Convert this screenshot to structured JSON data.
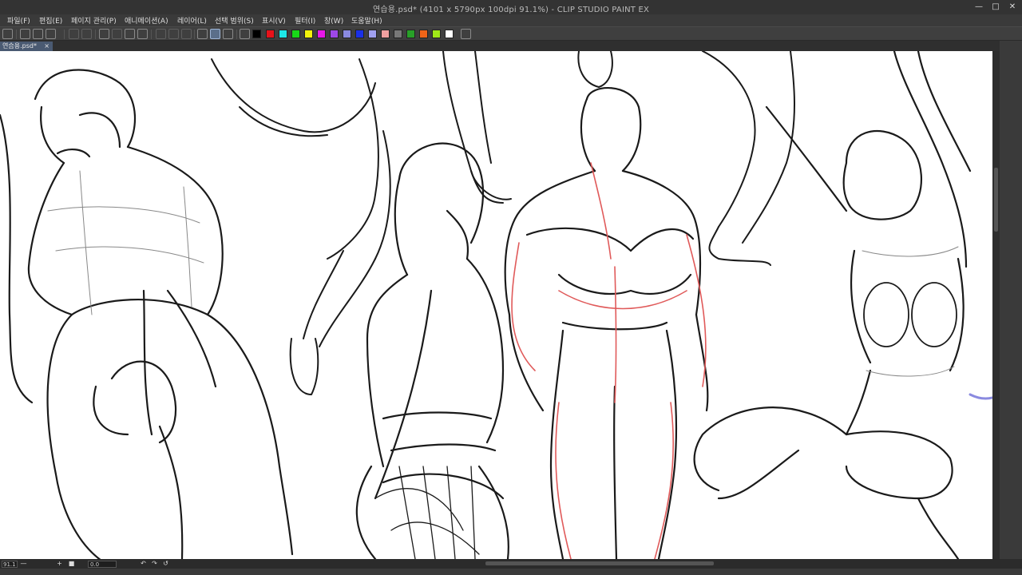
{
  "window": {
    "title": "연습용.psd* (4101 x 5790px 100dpi 91.1%)  - CLIP STUDIO PAINT EX",
    "controls": [
      "—",
      "□",
      "✕"
    ]
  },
  "menu": {
    "items": [
      "파일(F)",
      "편집(E)",
      "페이지 관리(P)",
      "애니메이션(A)",
      "레이어(L)",
      "선택 범위(S)",
      "표시(V)",
      "필터(I)",
      "창(W)",
      "도움말(H)"
    ]
  },
  "toolbar": {
    "icons": [
      "navigator-icon",
      "new-file-icon",
      "open-file-icon",
      "save-icon",
      "undo-icon",
      "redo-icon",
      "clear-icon",
      "fill-icon",
      "transform-icon",
      "select-icon",
      "invert-selection-icon",
      "deselect-icon",
      "pen-icon",
      "brush-icon",
      "eraser-icon",
      "help-icon"
    ],
    "swatches": [
      "#000000",
      "#e8121a",
      "#1ee8e8",
      "#18d818",
      "#f2f20c",
      "#e818e8",
      "#9e48e8",
      "#8a8ae0",
      "#1a30e8",
      "#a0a0f0",
      "#f0a0a0",
      "#787878",
      "#28a028",
      "#f06418",
      "#a0e818",
      "#ffffff"
    ]
  },
  "document_tab": {
    "label": "연습용.psd*",
    "close": "×"
  },
  "status": {
    "zoom": "91.1",
    "angle": "0.0",
    "buttons": [
      "—",
      "+",
      "■",
      "↶",
      "↷",
      "↺"
    ]
  },
  "colors": {
    "line_art": "#1a1a1a",
    "construction": "#e05a5a",
    "canvas": "#ffffff",
    "chrome": "#3a3a3a"
  }
}
